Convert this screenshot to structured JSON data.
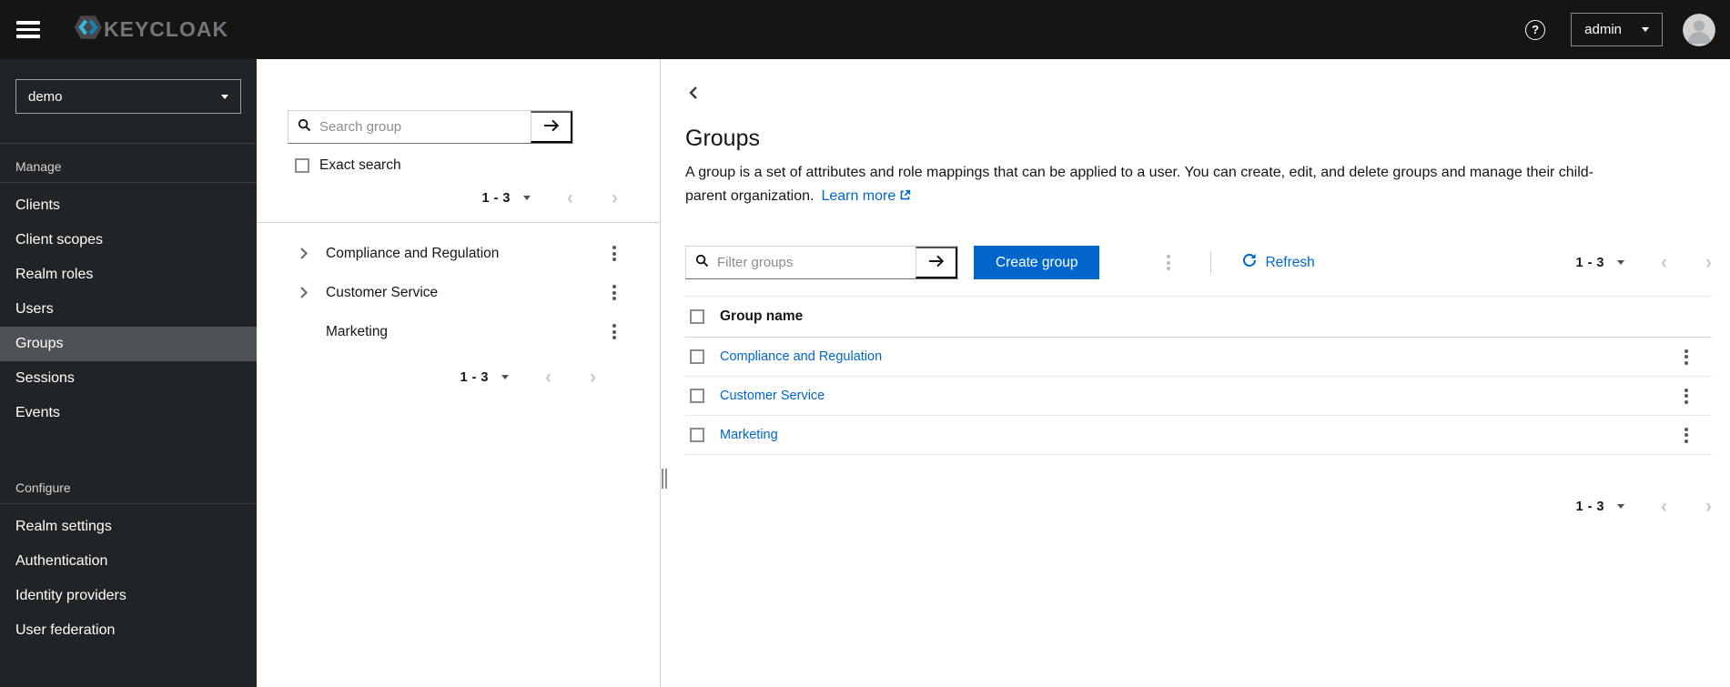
{
  "topbar": {
    "brand_text": "KEYCLOAK",
    "user_menu_label": "admin"
  },
  "sidebar": {
    "realm_selector_value": "demo",
    "manage": {
      "label": "Manage",
      "items": [
        "Clients",
        "Client scopes",
        "Realm roles",
        "Users",
        "Groups",
        "Sessions",
        "Events"
      ],
      "active_item": "Groups"
    },
    "configure": {
      "label": "Configure",
      "items": [
        "Realm settings",
        "Authentication",
        "Identity providers",
        "User federation"
      ]
    }
  },
  "tree_panel": {
    "search_placeholder": "Search group",
    "exact_search_label": "Exact search",
    "exact_search_checked": false,
    "pagination_top": {
      "range": "1 - 3"
    },
    "pagination_bottom": {
      "range": "1 - 3"
    },
    "items": [
      {
        "label": "Compliance and Regulation",
        "expandable": true
      },
      {
        "label": "Customer Service",
        "expandable": true
      },
      {
        "label": "Marketing",
        "expandable": false
      }
    ]
  },
  "main": {
    "title": "Groups",
    "description": "A group is a set of attributes and role mappings that can be applied to a user. You can create, edit, and delete groups and manage their child-parent organization.",
    "learn_more_label": "Learn more",
    "toolbar": {
      "filter_placeholder": "Filter groups",
      "create_button_label": "Create group",
      "refresh_label": "Refresh",
      "pagination": {
        "range": "1 - 3"
      }
    },
    "table": {
      "header": "Group name",
      "rows": [
        {
          "name": "Compliance and Regulation"
        },
        {
          "name": "Customer Service"
        },
        {
          "name": "Marketing"
        }
      ]
    },
    "pagination_bottom": {
      "range": "1 - 3"
    }
  },
  "icons": {
    "help": "?",
    "chevron_left": "‹",
    "chevron_right": "›"
  },
  "colors": {
    "primary": "#0066cc",
    "link": "#0066cc",
    "topbar_bg": "#151515",
    "sidebar_bg": "#212427",
    "sidebar_active_bg": "#4f5255",
    "logo_blue_light": "#36b9e5",
    "logo_blue_dark": "#1786b0",
    "brand_gray": "#72767b"
  }
}
